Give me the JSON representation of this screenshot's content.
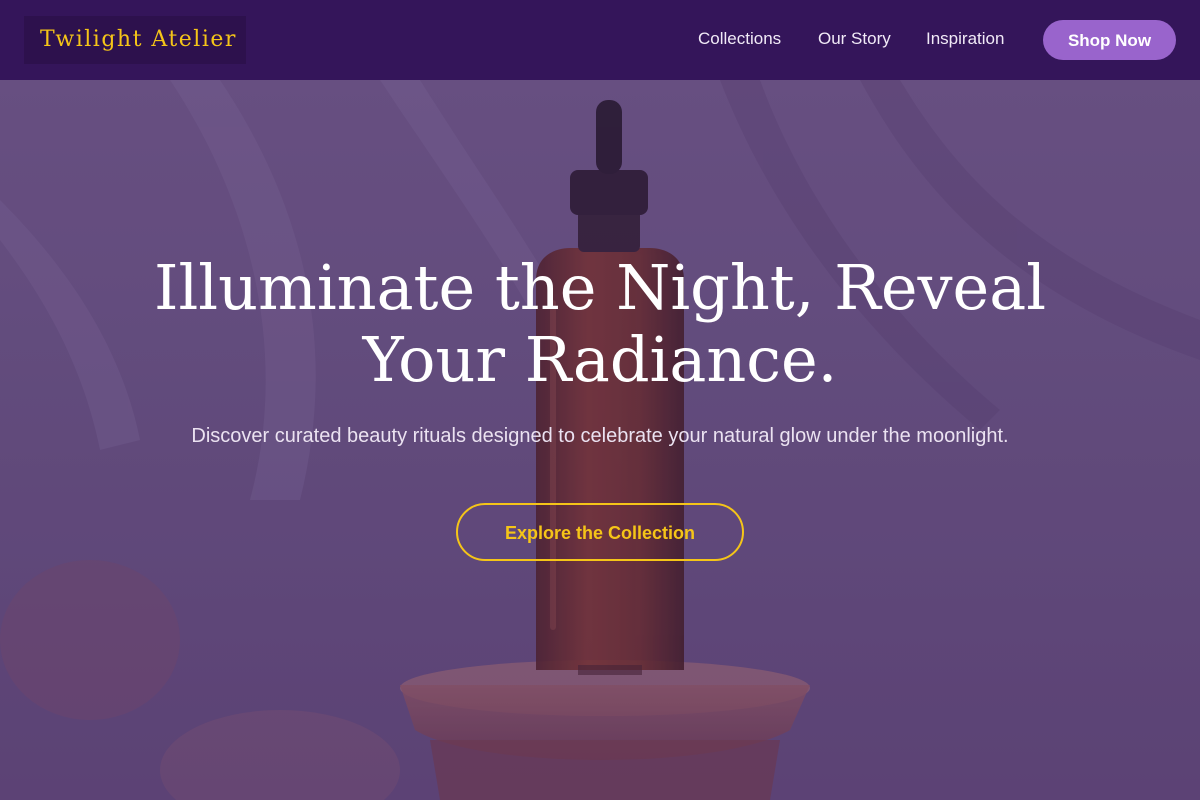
{
  "brand": {
    "name": "Twilight Atelier"
  },
  "nav": {
    "links": [
      {
        "label": "Collections"
      },
      {
        "label": "Our Story"
      },
      {
        "label": "Inspiration"
      }
    ],
    "cta_label": "Shop Now"
  },
  "hero": {
    "title": "Illuminate the Night, Reveal Your Radiance.",
    "subtitle": "Discover curated beauty rituals designed to celebrate your natural glow under the moonlight.",
    "cta_label": "Explore the Collection",
    "image_label": "dusk beauty"
  },
  "colors": {
    "nav_background": "#34155a",
    "logo_background": "#2d114d",
    "accent_gold": "#f5c518",
    "shop_button": "#9964cc",
    "hero_overlay": "#6c5683",
    "bottle_amber": "#6a2b25"
  }
}
